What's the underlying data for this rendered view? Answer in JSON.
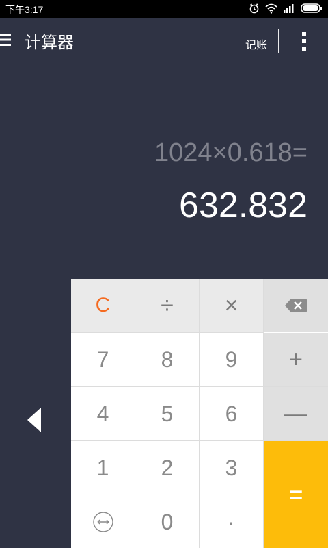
{
  "status_bar": {
    "time": "下午3:17",
    "icons": [
      "alarm-icon",
      "wifi-icon",
      "signal-icon",
      "battery-icon"
    ]
  },
  "app_bar": {
    "title": "计算器",
    "record_label": "记账"
  },
  "display": {
    "expression": "1024×0.618=",
    "result": "632.832"
  },
  "keypad": {
    "clear": "C",
    "divide": "÷",
    "multiply": "×",
    "plus": "+",
    "minus": "—",
    "equals": "=",
    "dot": "·",
    "digits": {
      "d0": "0",
      "d1": "1",
      "d2": "2",
      "d3": "3",
      "d4": "4",
      "d5": "5",
      "d6": "6",
      "d7": "7",
      "d8": "8",
      "d9": "9"
    }
  },
  "colors": {
    "background": "#2f3344",
    "accent_equals": "#fdbc0a",
    "clear_text": "#f56b21"
  }
}
